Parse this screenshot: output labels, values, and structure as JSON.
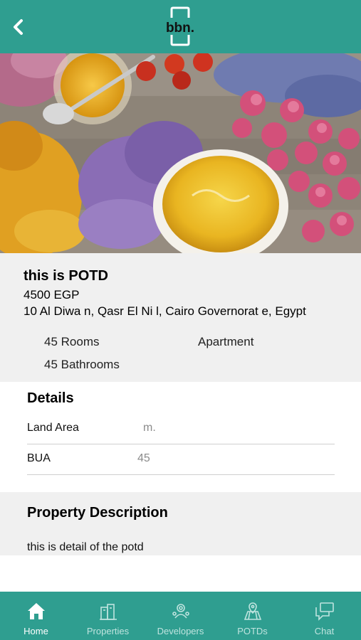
{
  "header": {
    "logo_text": "bbn."
  },
  "property": {
    "title": "this is POTD",
    "price": "4500 EGP",
    "address": "10 Al Diwa n, Qasr El Ni l, Cairo Governorat e, Egypt",
    "rooms": "45 Rooms",
    "type": "Apartment",
    "bathrooms": "45 Bathrooms"
  },
  "details": {
    "heading": "Details",
    "rows": [
      {
        "label": "Land Area",
        "value": "m."
      },
      {
        "label": "BUA",
        "value": "45"
      }
    ]
  },
  "description": {
    "heading": "Property Description",
    "text": "this is detail of the potd"
  },
  "tabs": [
    {
      "label": "Home",
      "icon": "home-icon",
      "active": true
    },
    {
      "label": "Properties",
      "icon": "buildings-icon",
      "active": false
    },
    {
      "label": "Developers",
      "icon": "developers-icon",
      "active": false
    },
    {
      "label": "POTDs",
      "icon": "map-pin-icon",
      "active": false
    },
    {
      "label": "Chat",
      "icon": "chat-icon",
      "active": false
    }
  ],
  "colors": {
    "brand": "#2f9e90",
    "tab_active": "#ffffff",
    "tab_inactive": "#bfe4df"
  }
}
